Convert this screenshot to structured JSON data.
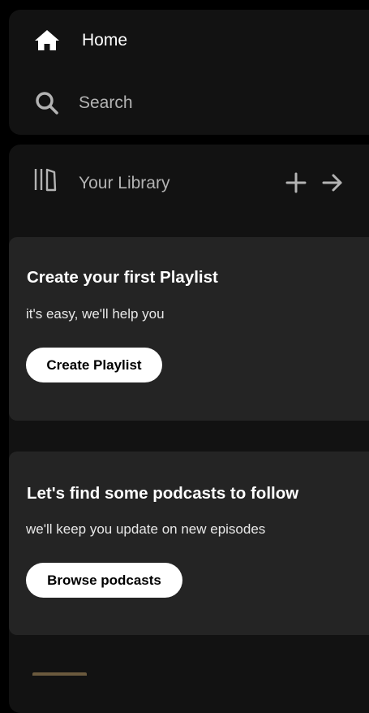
{
  "nav": {
    "home_label": "Home",
    "home_icon": "home-icon",
    "search_label": "Search",
    "search_icon": "search-icon"
  },
  "library": {
    "label": "Your Library",
    "icon": "library-icon",
    "add_icon": "plus-icon",
    "expand_icon": "arrow-right-icon"
  },
  "cards": [
    {
      "title": "Create your first Playlist",
      "subtitle": "it's easy, we'll help you",
      "button_label": "Create Playlist"
    },
    {
      "title": "Let's find some podcasts to follow",
      "subtitle": "we'll keep you update on new episodes",
      "button_label": "Browse podcasts"
    }
  ],
  "colors": {
    "background": "#000000",
    "panel": "#121212",
    "card": "#242424",
    "text_primary": "#ffffff",
    "text_secondary": "#b3b3b3",
    "button_bg": "#ffffff"
  }
}
